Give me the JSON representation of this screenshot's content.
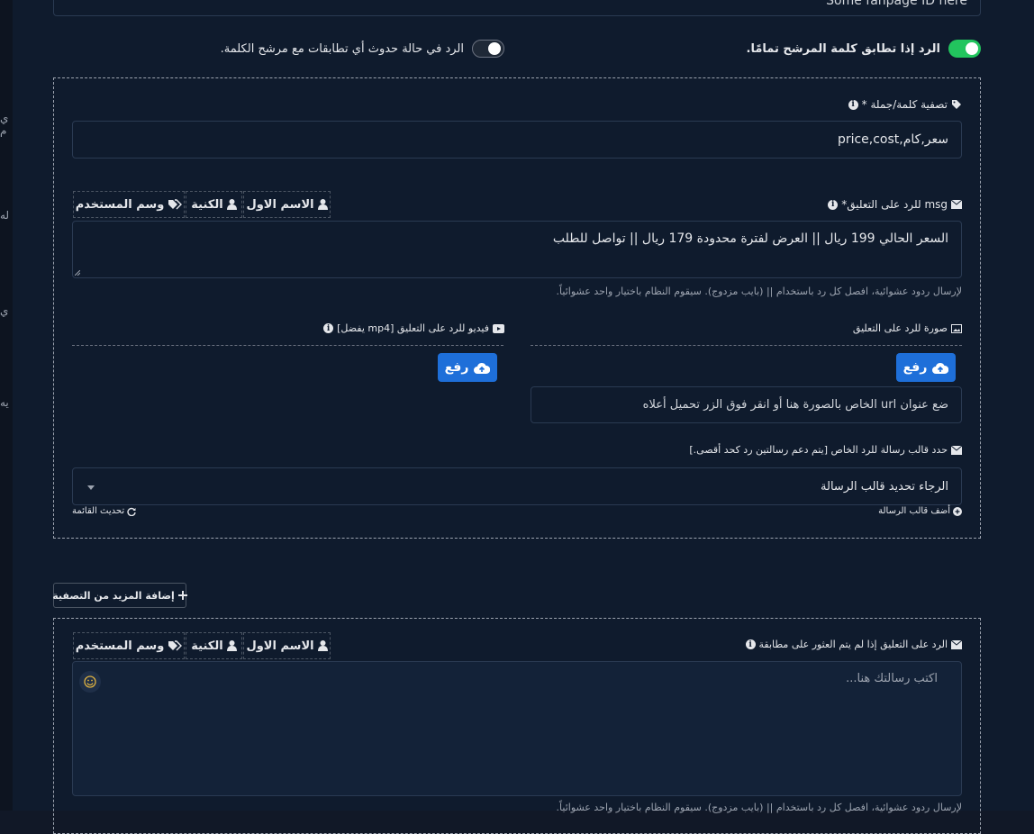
{
  "top_input_value": "Some fanpage ID here",
  "toggles": {
    "exact": {
      "label": "الرد إذا تطابق كلمة المرشح تمامًا.",
      "on": true
    },
    "any": {
      "label": "الرد في حالة حدوث أي تطابقات مع مرشح الكلمة.",
      "on": false
    }
  },
  "filter_block": {
    "filter_label": "تصفية كلمة/جملة *",
    "filter_value": "سعر,كام,price,cost",
    "msg_label": "msg للرد على التعليق*",
    "msg_value": "السعر الحالي 199 ريال || العرض لفترة محدودة 179 ريال || تواصل للطلب",
    "tags": {
      "first_name": "الاسم الاول",
      "last_name": "الكنية",
      "user_tag": "وسم المستخدم"
    },
    "random_help": "لإرسال ردود عشوائية، افصل كل رد باستخدام || (بايب مزدوج). سيقوم النظام باختيار واحد عشوائياً.",
    "image_label": "صورة للرد على التعليق",
    "video_label": "فيديو للرد على التعليق [mp4 يفضل]",
    "upload_label": "رفع",
    "image_url_placeholder": "ضع عنوان url الخاص بالصورة هنا أو انقر فوق الزر تحميل أعلاه",
    "template_label": "حدد قالب رسالة للرد الخاص [يتم دعم رسالتين رد كحد أقصى.]",
    "template_select_value": "الرجاء تحديد قالب الرسالة",
    "add_template": "أضف قالب الرسالة",
    "refresh_list": "تحديث القائمة"
  },
  "add_more_filter": "إضافة المزيد من التصفية",
  "no_match_block": {
    "label": "الرد على التعليق إذا لم يتم العثور على مطابقة",
    "placeholder": "اكتب رسالتك هنا...",
    "tags": {
      "first_name": "الاسم الاول",
      "last_name": "الكنية",
      "user_tag": "وسم المستخدم"
    },
    "random_help": "لإرسال ردود عشوائية، افصل كل رد باستخدام || (بايب مزدوج). سيقوم النظام باختيار واحد عشوائياً."
  },
  "left_fragments": [
    "ي م",
    "له",
    "ي",
    "يه"
  ],
  "colors": {
    "toggle_on": "#22c55e",
    "toggle_off": "#1f2937",
    "primary": "#1e6fd9",
    "panel": "#0f1b2d"
  }
}
